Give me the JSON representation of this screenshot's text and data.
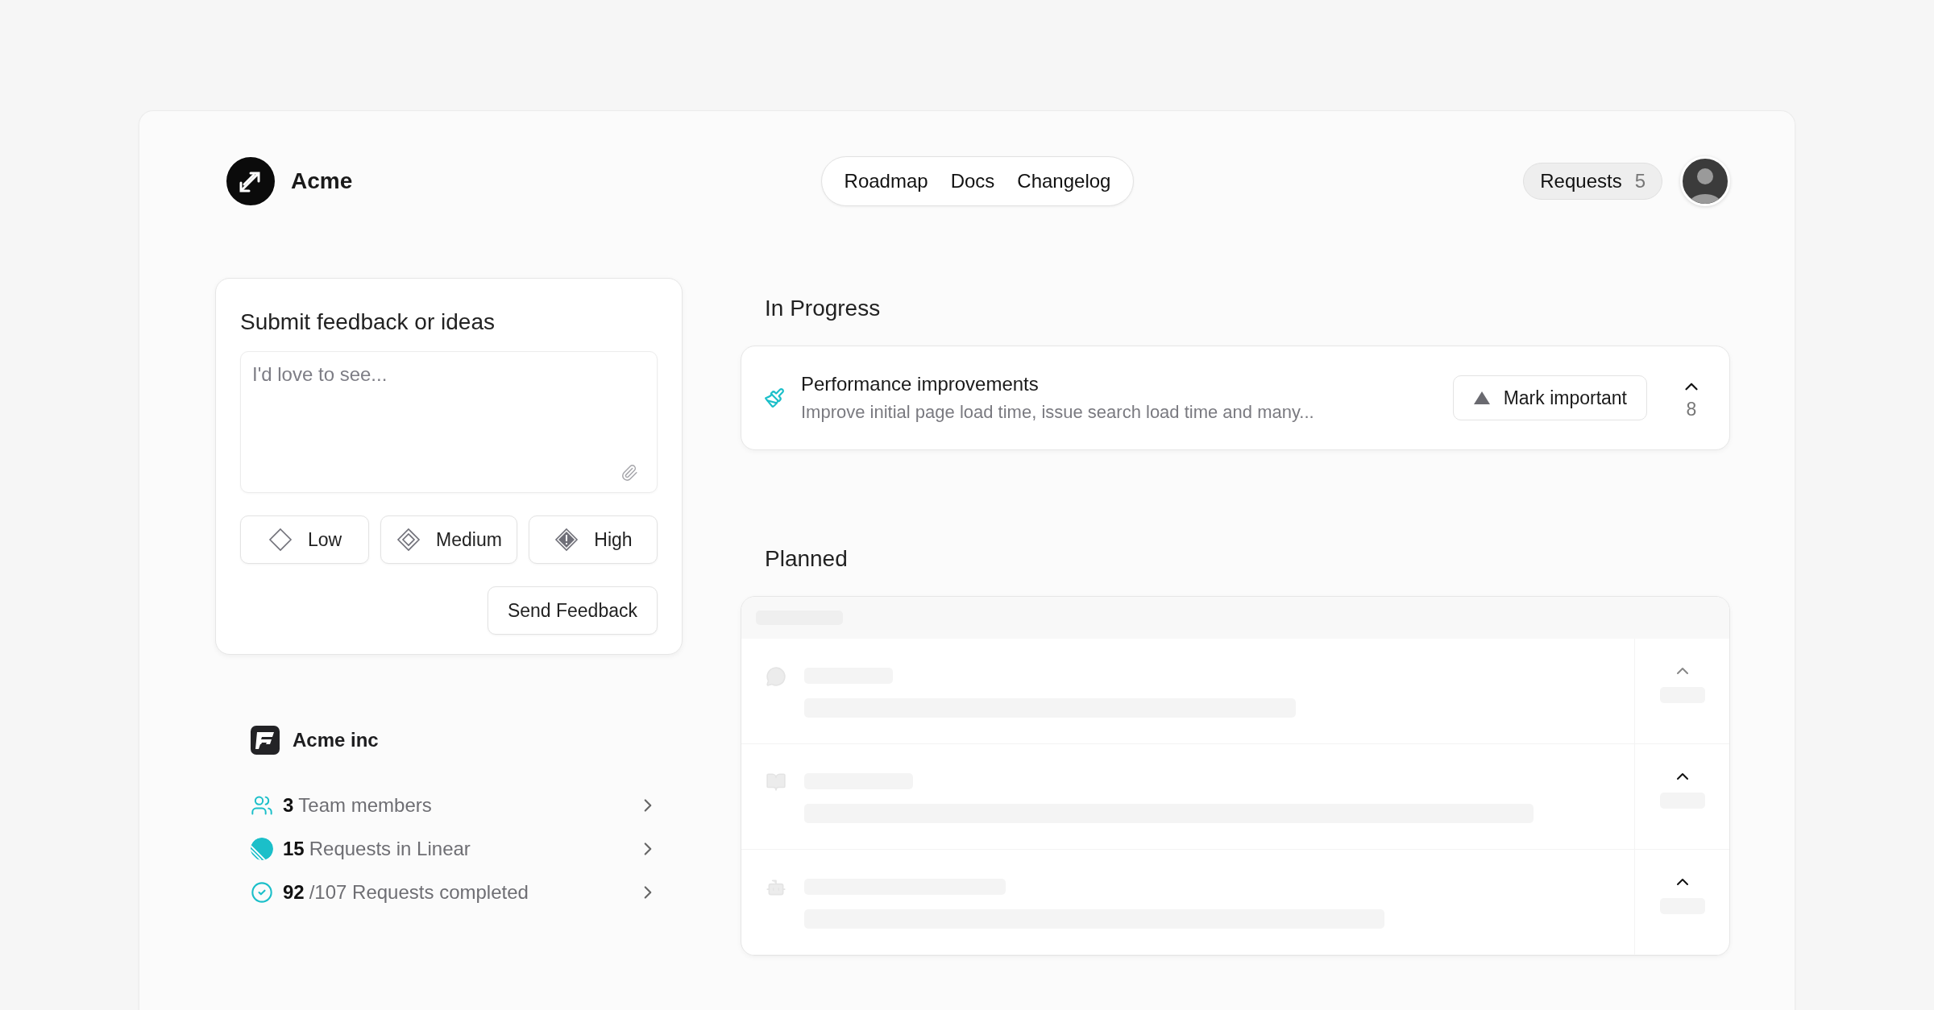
{
  "brand": {
    "name": "Acme"
  },
  "nav": [
    {
      "label": "Roadmap"
    },
    {
      "label": "Docs"
    },
    {
      "label": "Changelog"
    }
  ],
  "requests": {
    "label": "Requests",
    "count": "5"
  },
  "feedback": {
    "title": "Submit feedback or ideas",
    "placeholder": "I'd love to see...",
    "priorities": [
      {
        "kind": "low",
        "label": "Low"
      },
      {
        "kind": "medium",
        "label": "Medium"
      },
      {
        "kind": "high",
        "label": "High"
      }
    ],
    "submit": "Send Feedback"
  },
  "org": {
    "name": "Acme inc",
    "stats": [
      {
        "kind": "team",
        "count": "3",
        "label": "Team members"
      },
      {
        "kind": "linear",
        "count": "15",
        "label": "Requests in Linear"
      },
      {
        "kind": "completed",
        "count": "92",
        "label": "/107 Requests completed"
      }
    ]
  },
  "in_progress": {
    "title": "In Progress",
    "items": [
      {
        "title": "Performance improvements",
        "description": "Improve initial page load time, issue search load time and many...",
        "action": "Mark important",
        "votes": "8"
      }
    ]
  },
  "planned": {
    "title": "Planned",
    "loading": true
  }
}
